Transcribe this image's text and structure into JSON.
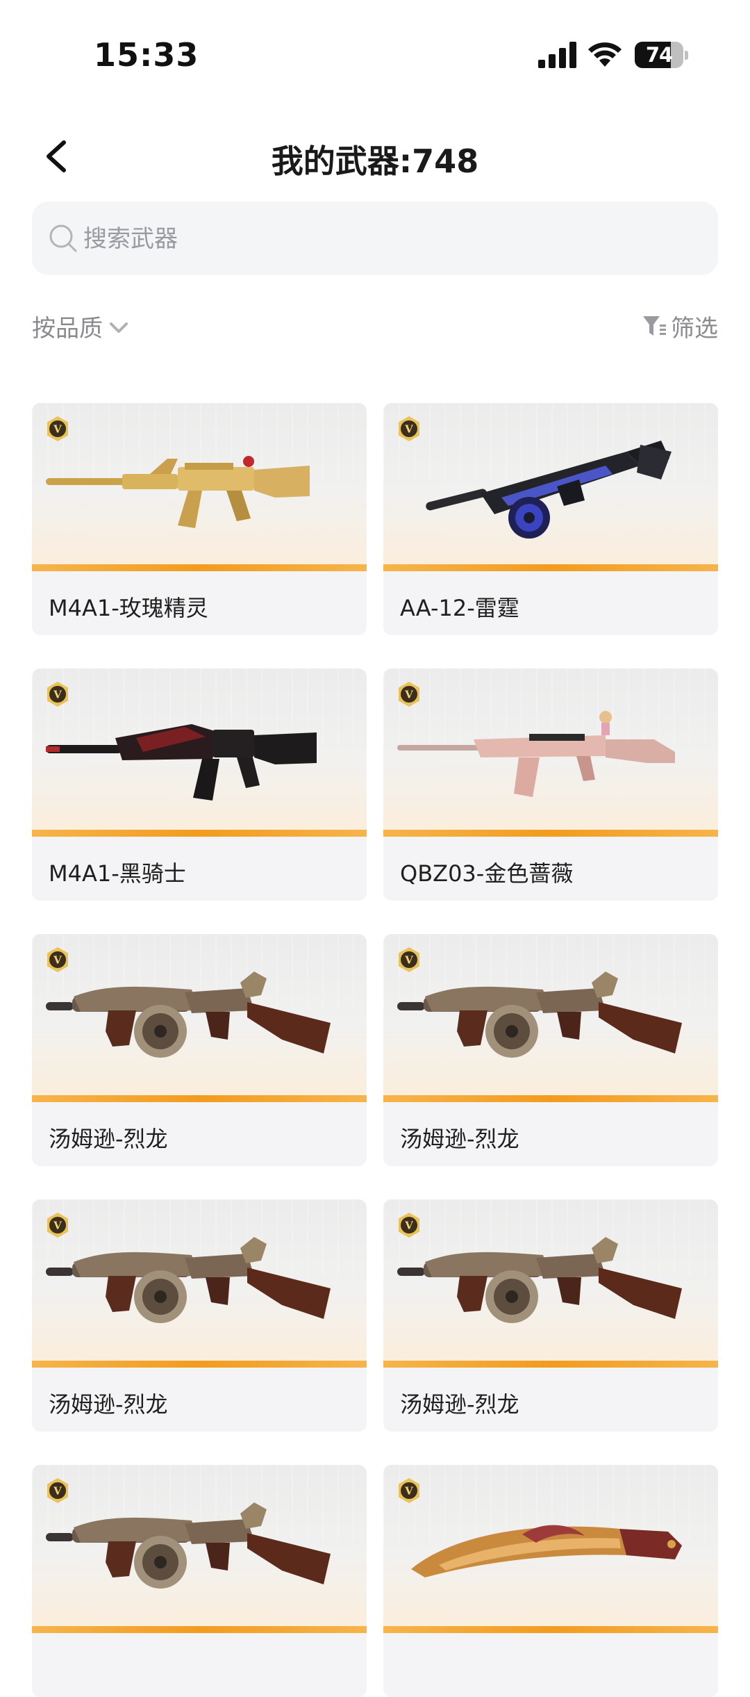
{
  "status_bar": {
    "time": "15:33",
    "battery": "74",
    "battery_level": 0.74
  },
  "header": {
    "title": "我的武器:748"
  },
  "search": {
    "placeholder": "搜索武器",
    "value": ""
  },
  "toolbar": {
    "sort_label": "按品质",
    "filter_label": "筛选"
  },
  "colors": {
    "accent_gold": "#f29c1f",
    "card_bg": "#f4f4f6"
  },
  "weapons": [
    {
      "name": "M4A1-玫瑰精灵",
      "icon": "rifle-gold-icon"
    },
    {
      "name": "AA-12-雷霆",
      "icon": "shotgun-drum-blue-icon"
    },
    {
      "name": "M4A1-黑骑士",
      "icon": "rifle-dark-dragon-icon"
    },
    {
      "name": "QBZ03-金色蔷薇",
      "icon": "rifle-pink-icon"
    },
    {
      "name": "汤姆逊-烈龙",
      "icon": "tommy-gun-dragon-icon"
    },
    {
      "name": "汤姆逊-烈龙",
      "icon": "tommy-gun-dragon-icon"
    },
    {
      "name": "汤姆逊-烈龙",
      "icon": "tommy-gun-dragon-icon"
    },
    {
      "name": "汤姆逊-烈龙",
      "icon": "tommy-gun-dragon-icon"
    },
    {
      "name": "",
      "icon": "tommy-gun-dragon-icon"
    },
    {
      "name": "",
      "icon": "kukri-knife-icon"
    }
  ]
}
